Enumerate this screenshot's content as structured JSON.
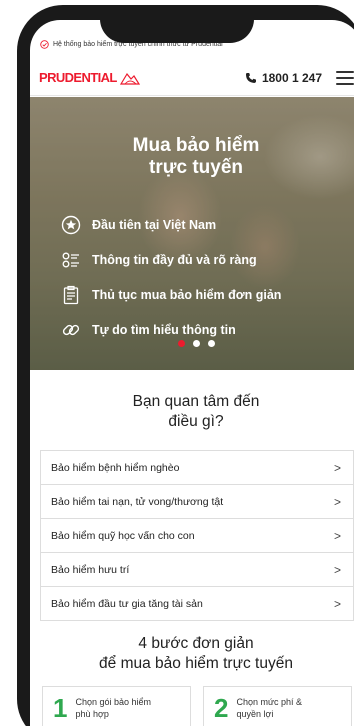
{
  "topbar": {
    "text": "Hệ thống bảo hiểm trực tuyến chính thức từ Prudential"
  },
  "header": {
    "logo": "PRUDENTIAL",
    "hotline": "1800 1 247"
  },
  "hero": {
    "title_line1": "Mua bảo hiểm",
    "title_line2": "trực tuyến",
    "features": [
      {
        "label": "Đầu tiên tại Việt Nam",
        "icon": "star-circle-icon"
      },
      {
        "label": "Thông tin đầy đủ và rõ ràng",
        "icon": "checklist-icon"
      },
      {
        "label": "Thủ tục mua bảo hiểm đơn giản",
        "icon": "clipboard-icon"
      },
      {
        "label": "Tự do tìm hiểu thông tin",
        "icon": "link-icon"
      }
    ],
    "slides": 3,
    "active_slide": 1
  },
  "interest": {
    "line1": "Bạn quan tâm đến",
    "line2": "điều gì?"
  },
  "insurance_list": [
    "Bảo hiểm bệnh hiểm nghèo",
    "Bảo hiểm tai nạn, tử vong/thương tật",
    "Bảo hiểm quỹ học vấn cho con",
    "Bảo hiểm hưu trí",
    "Bảo hiểm đầu tư gia tăng tài sản"
  ],
  "steps": {
    "title_line1": "4 bước đơn giản",
    "title_line2": "để mua bảo hiểm trực tuyến",
    "items": [
      {
        "number": "1",
        "line1": "Chọn gói bảo hiểm",
        "line2": "phù hợp"
      },
      {
        "number": "2",
        "line1": "Chọn mức phí &",
        "line2": "quyền lợi"
      }
    ]
  },
  "colors": {
    "brand_red": "#ed1b2e",
    "step_green": "#2fa84f"
  }
}
